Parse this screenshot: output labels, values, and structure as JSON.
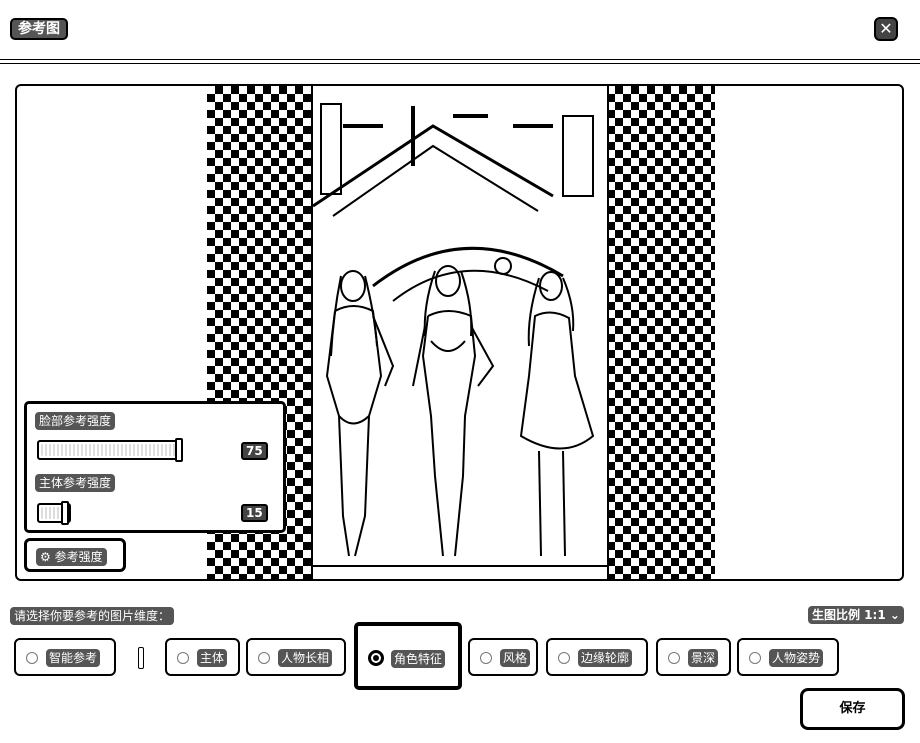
{
  "header": {
    "title": "参考图",
    "close_icon": "close-icon"
  },
  "preview": {
    "background": "transparency-checkerboard",
    "image_description_icon": "reference-photo"
  },
  "strength_panel": {
    "face_label": "脸部参考强度",
    "face_value": "75",
    "face_fraction": 0.75,
    "subject_label": "主体参考强度",
    "subject_value": "15",
    "subject_fraction": 0.15,
    "toggle_label": "参考强度",
    "toggle_icon": "sliders-icon"
  },
  "dimension_prompt": "请选择你要参考的图片维度：",
  "aspect_ratio": {
    "label": "生图比例 1:1",
    "icon": "chevron-down-icon"
  },
  "dimensions": [
    {
      "label": "智能参考",
      "selected": false
    },
    {
      "label": "主体",
      "selected": false
    },
    {
      "label": "人物长相",
      "selected": false
    },
    {
      "label": "角色特征",
      "selected": true
    },
    {
      "label": "风格",
      "selected": false
    },
    {
      "label": "边缘轮廓",
      "selected": false
    },
    {
      "label": "景深",
      "selected": false
    },
    {
      "label": "人物姿势",
      "selected": false
    }
  ],
  "save_label": "保存"
}
